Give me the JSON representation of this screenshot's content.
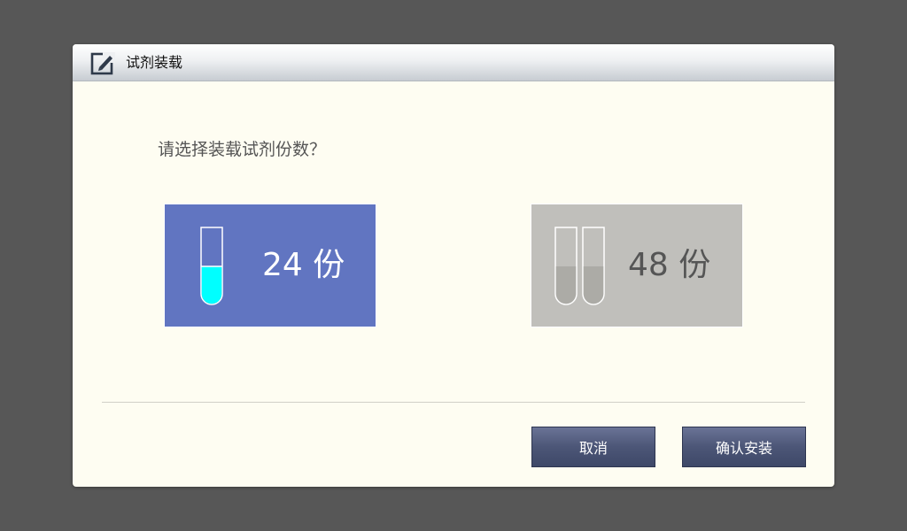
{
  "dialog": {
    "title": "试剂装载",
    "title_icon": "edit-icon",
    "prompt": "请选择装载试剂份数？"
  },
  "options": [
    {
      "label": "24 份",
      "tubes": 1,
      "selected": true,
      "icon": "single-test-tube-icon"
    },
    {
      "label": "48 份",
      "tubes": 2,
      "selected": false,
      "icon": "double-test-tube-icon"
    }
  ],
  "buttons": {
    "cancel": "取消",
    "confirm": "确认安装"
  },
  "colors": {
    "selected_bg": "#6175c1",
    "unselected_bg": "#c0bfbb",
    "liquid_active": "#00ffff",
    "button_bg": "#4c5677",
    "dialog_bg": "#fefdf2"
  }
}
